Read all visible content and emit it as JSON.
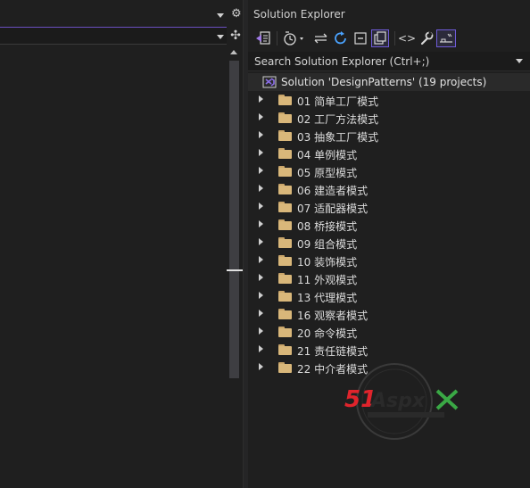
{
  "solution_explorer": {
    "title": "Solution Explorer",
    "search_placeholder": "Search Solution Explorer (Ctrl+;)",
    "solution_label": "Solution 'DesignPatterns' (19 projects)",
    "toolbar_icons": [
      "switch-views-icon",
      "pending-changes-filter-icon",
      "sync-with-active-document-icon",
      "refresh-icon",
      "collapse-all-icon",
      "show-all-files-icon",
      "view-code-icon",
      "properties-icon",
      "preview-selected-items-icon"
    ],
    "projects": [
      {
        "label": "01 简单工厂模式"
      },
      {
        "label": "02 工厂方法模式"
      },
      {
        "label": "03 抽象工厂模式"
      },
      {
        "label": "04 单例模式"
      },
      {
        "label": "05 原型模式"
      },
      {
        "label": "06 建造者模式"
      },
      {
        "label": "07 适配器模式"
      },
      {
        "label": "08 桥接模式"
      },
      {
        "label": "09 组合模式"
      },
      {
        "label": "10 装饰模式"
      },
      {
        "label": "11 外观模式"
      },
      {
        "label": "13 代理模式"
      },
      {
        "label": "16 观察者模式"
      },
      {
        "label": "20 命令模式"
      },
      {
        "label": "21 责任链模式"
      },
      {
        "label": "22 中介者模式"
      }
    ]
  },
  "watermark": {
    "brand": "51Aspx"
  },
  "colors": {
    "background": "#1f1f1f",
    "accent": "#6e5bd8",
    "folder": "#d9b77a",
    "solution_icon": "#8b6ee8"
  }
}
